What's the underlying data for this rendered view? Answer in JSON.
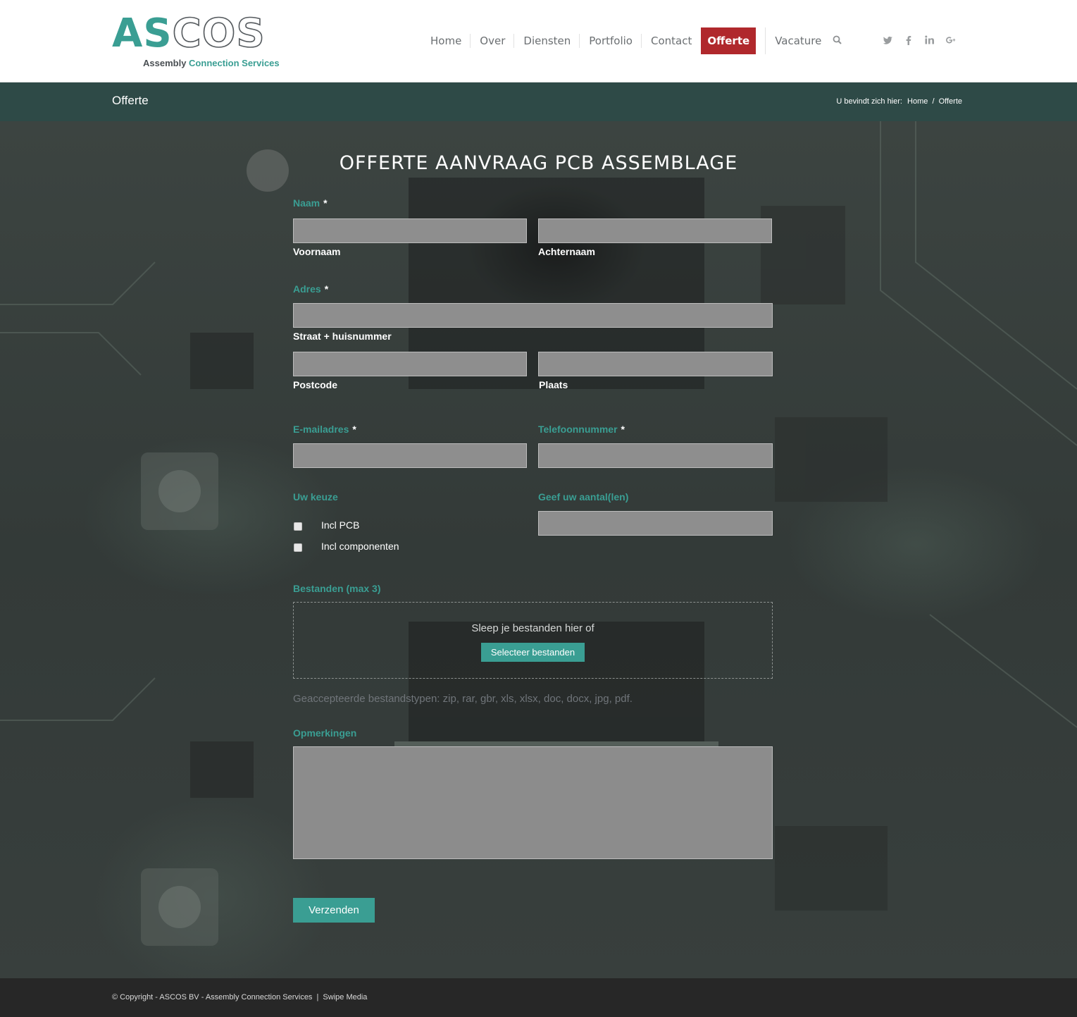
{
  "brand": {
    "logo_part1": "AS",
    "logo_part2": "COS",
    "tagline_part1": "Assembly",
    "tagline_part2": "Connection Services",
    "accent_color": "#3a9e93"
  },
  "nav": {
    "items": [
      {
        "label": "Home"
      },
      {
        "label": "Over"
      },
      {
        "label": "Diensten"
      },
      {
        "label": "Portfolio"
      },
      {
        "label": "Contact"
      },
      {
        "label": "Offerte",
        "active": true
      },
      {
        "label": "Vacature"
      }
    ],
    "active_color": "#b0282c",
    "search_icon": "search-icon",
    "social_icons": [
      "twitter-icon",
      "facebook-icon",
      "linkedin-icon",
      "google-plus-icon"
    ]
  },
  "titlebar": {
    "title": "Offerte",
    "crumb_prefix": "U bevindt zich hier:",
    "crumb_home": "Home",
    "crumb_separator": "/",
    "crumb_current": "Offerte"
  },
  "form": {
    "title": "OFFERTE AANVRAAG PCB ASSEMBLAGE",
    "required_mark": "*",
    "name_label": "Naam",
    "firstname_sub": "Voornaam",
    "lastname_sub": "Achternaam",
    "address_label": "Adres",
    "street_sub": "Straat + huisnummer",
    "postcode_sub": "Postcode",
    "city_sub": "Plaats",
    "email_label": "E-mailadres",
    "phone_label": "Telefoonnummer",
    "choice_label": "Uw keuze",
    "choice_options": [
      {
        "label": "Incl PCB",
        "checked": false
      },
      {
        "label": "Incl componenten",
        "checked": false
      }
    ],
    "quantity_label": "Geef uw aantal(len)",
    "files_label": "Bestanden (max 3)",
    "dropzone_text": "Sleep je bestanden hier of",
    "select_files_button": "Selecteer bestanden",
    "accepted_types": "Geaccepteerde bestandstypen: zip, rar, gbr, xls, xlsx, doc, docx, jpg, pdf.",
    "remarks_label": "Opmerkingen",
    "submit_label": "Verzenden"
  },
  "footer": {
    "copyright": "© Copyright - ASCOS BV - Assembly Connection Services",
    "separator": "|",
    "credit": "Swipe Media"
  }
}
